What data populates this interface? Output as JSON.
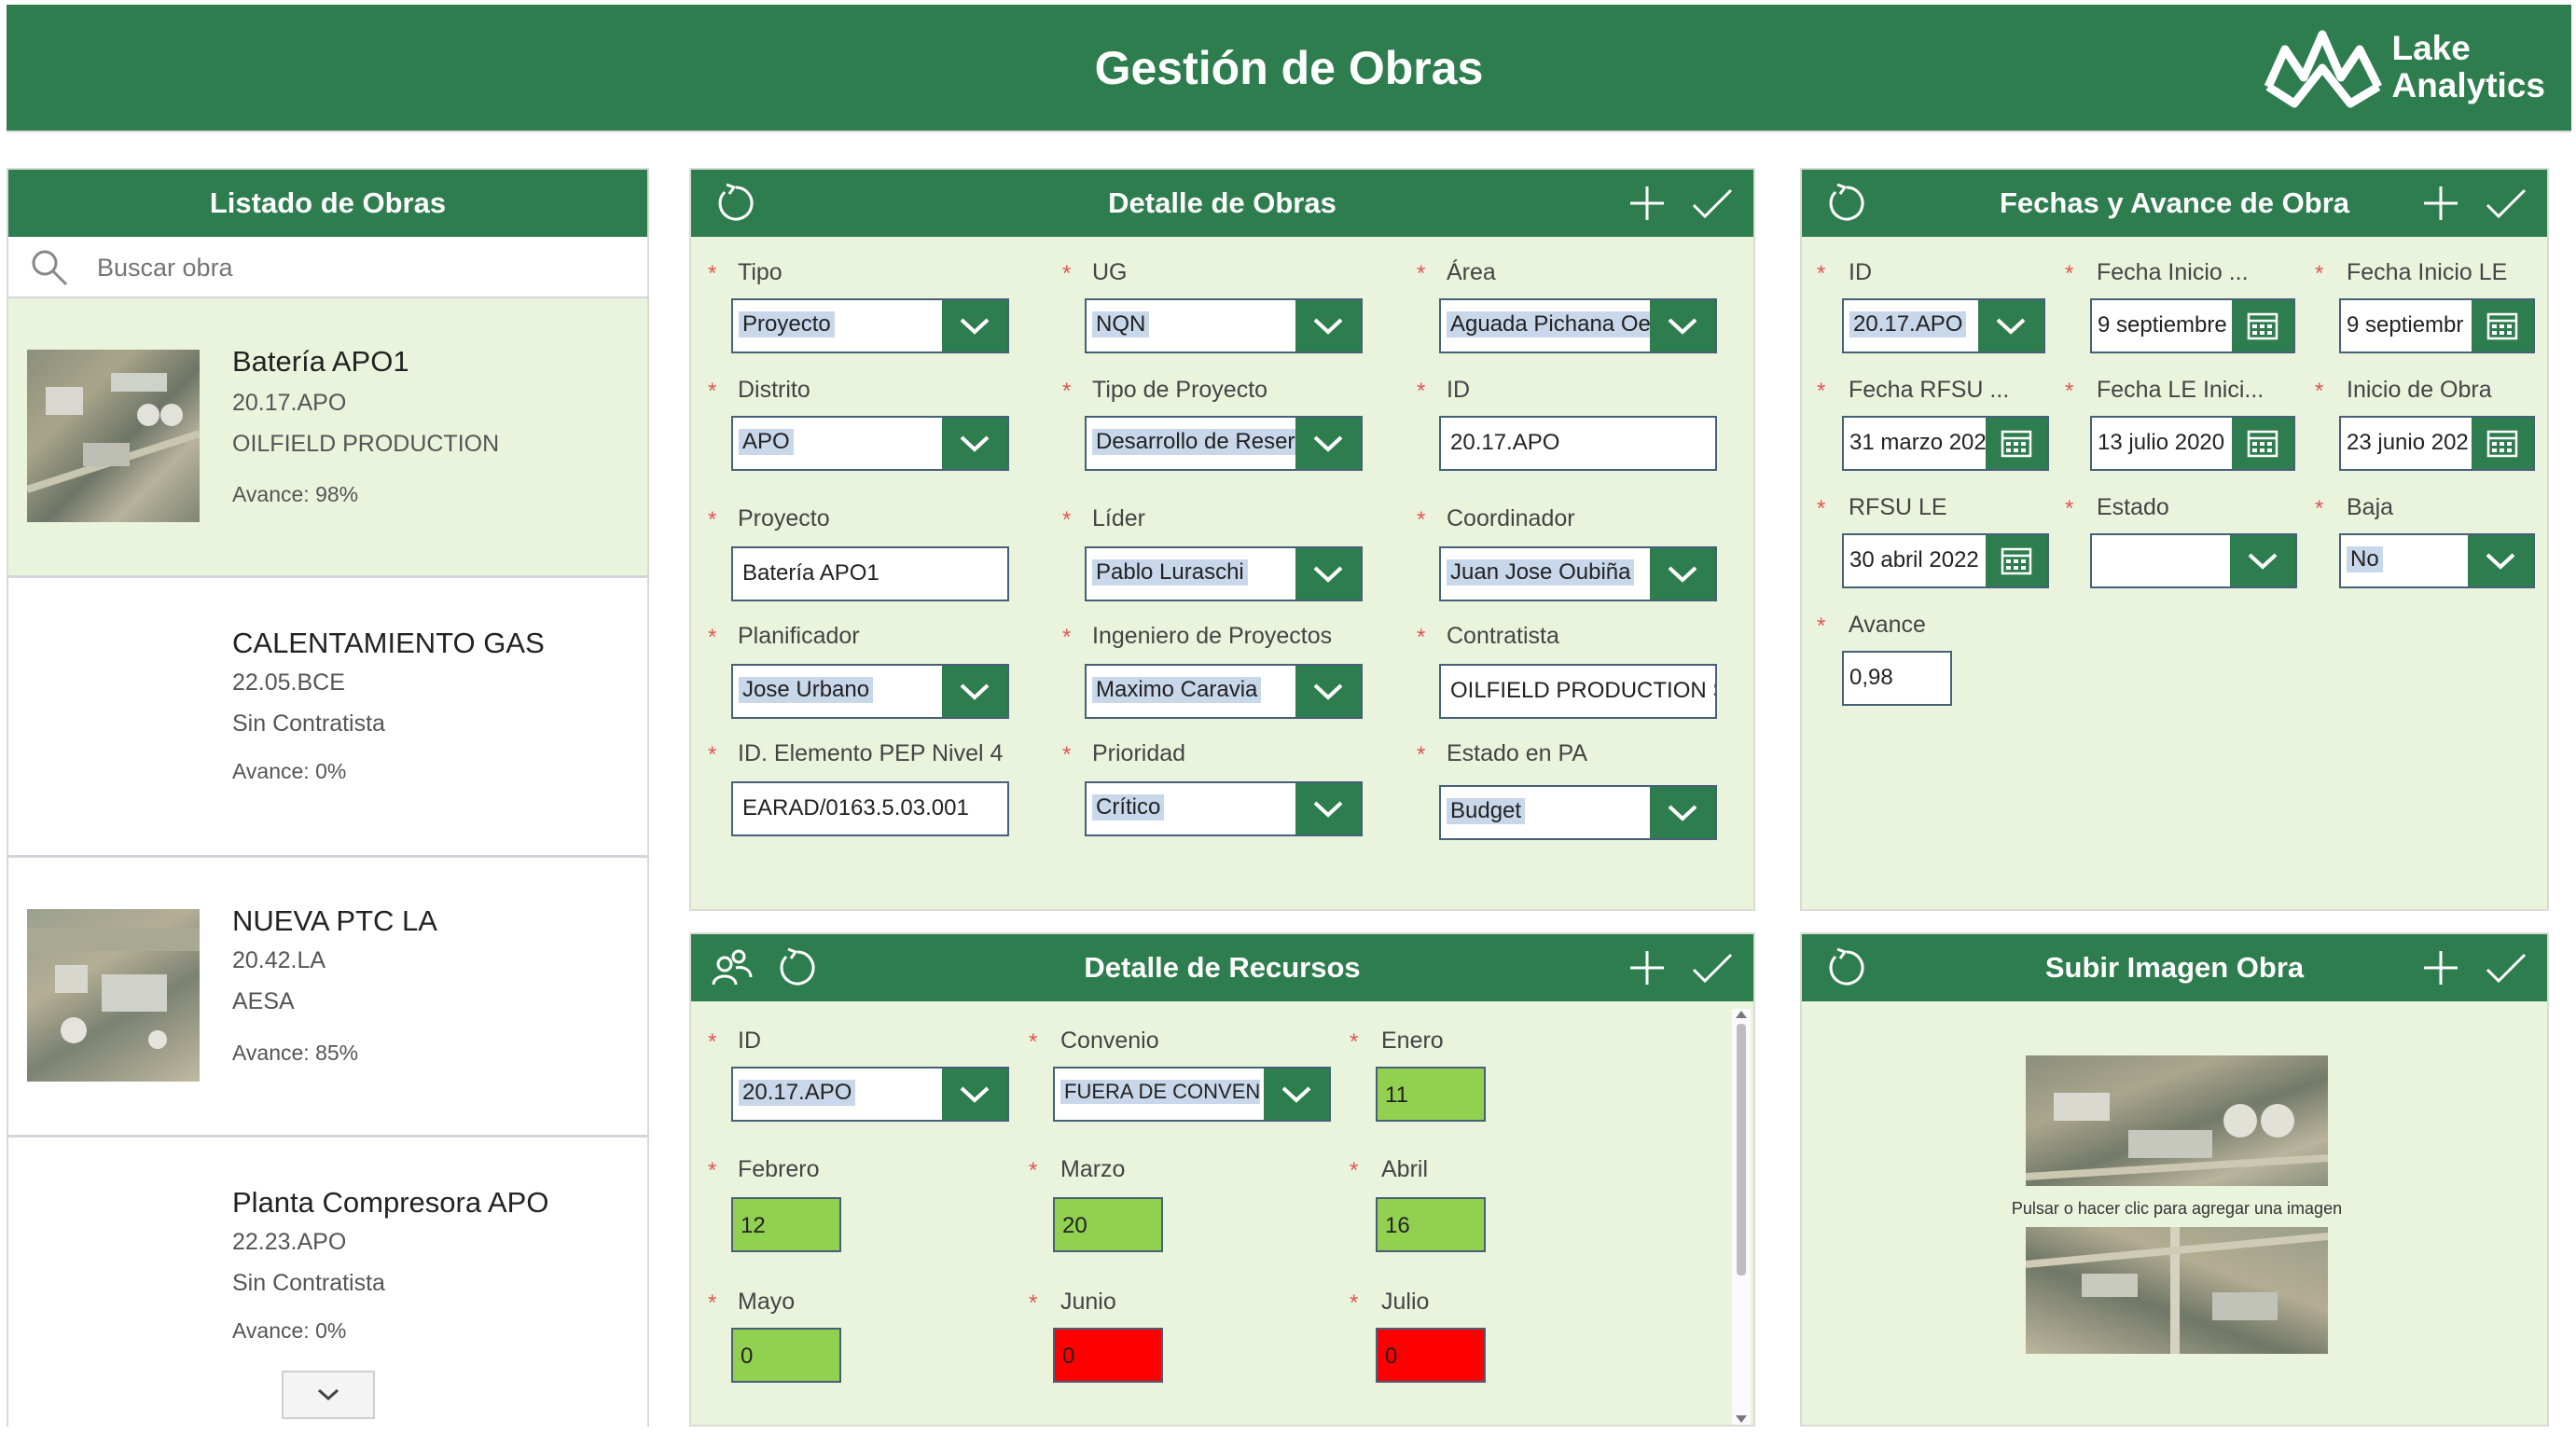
{
  "header": {
    "title": "Gestión de Obras",
    "logo_line1": "Lake",
    "logo_line2": "Analytics",
    "bg_color": "#2e7d4f"
  },
  "list_panel": {
    "title": "Listado de Obras",
    "search_placeholder": "Buscar obra",
    "items": [
      {
        "title": "Batería APO1",
        "code": "20.17.APO",
        "contractor": "OILFIELD PRODUCTION",
        "progress": "Avance: 98%",
        "has_image": true
      },
      {
        "title": "CALENTAMIENTO GAS",
        "code": "22.05.BCE",
        "contractor": "Sin Contratista",
        "progress": "Avance: 0%",
        "has_image": false
      },
      {
        "title": "NUEVA PTC LA",
        "code": "20.42.LA",
        "contractor": "AESA",
        "progress": "Avance: 85%",
        "has_image": true
      },
      {
        "title": "Planta Compresora APO",
        "code": "22.23.APO",
        "contractor": "Sin Contratista",
        "progress": "Avance: 0%",
        "has_image": false
      }
    ]
  },
  "detail_panel": {
    "title": "Detalle de Obras",
    "fields": {
      "tipo": {
        "label": "Tipo",
        "value": "Proyecto"
      },
      "ug": {
        "label": "UG",
        "value": "NQN"
      },
      "area": {
        "label": "Área",
        "value": "Aguada Pichana Oes"
      },
      "distrito": {
        "label": "Distrito",
        "value": "APO"
      },
      "tipo_proyecto": {
        "label": "Tipo de Proyecto",
        "value": "Desarrollo de Reserv"
      },
      "id": {
        "label": "ID",
        "value": "20.17.APO"
      },
      "proyecto": {
        "label": "Proyecto",
        "value": "Batería APO1"
      },
      "lider": {
        "label": "Líder",
        "value": "Pablo Luraschi"
      },
      "coordinador": {
        "label": "Coordinador",
        "value": "Juan Jose Oubiña"
      },
      "planificador": {
        "label": "Planificador",
        "value": "Jose Urbano"
      },
      "ingeniero": {
        "label": "Ingeniero de Proyectos",
        "value": "Maximo Caravia"
      },
      "contratista": {
        "label": "Contratista",
        "value": "OILFIELD PRODUCTION SER"
      },
      "pep": {
        "label": "ID. Elemento PEP Nivel 4",
        "value": "EARAD/0163.5.03.001"
      },
      "prioridad": {
        "label": "Prioridad",
        "value": "Crítico"
      },
      "estado_pa": {
        "label": "Estado en PA",
        "value": "Budget"
      }
    }
  },
  "fechas_panel": {
    "title": "Fechas y Avance de Obra",
    "fields": {
      "id": {
        "label": "ID",
        "value": "20.17.APO"
      },
      "fecha_inicio": {
        "label": "Fecha Inicio ...",
        "value": "9 septiembre"
      },
      "fecha_inicio_le": {
        "label": "Fecha Inicio LE",
        "value": "9 septiembr"
      },
      "fecha_rfsu": {
        "label": "Fecha RFSU ...",
        "value": "31 marzo 202"
      },
      "fecha_le_inici": {
        "label": "Fecha LE Inici...",
        "value": "13 julio 2020"
      },
      "inicio_obra": {
        "label": "Inicio de Obra",
        "value": "23 junio 202"
      },
      "rfsu_le": {
        "label": "RFSU LE",
        "value": "30 abril 2022"
      },
      "estado": {
        "label": "Estado",
        "value": ""
      },
      "baja": {
        "label": "Baja",
        "value": "No"
      },
      "avance": {
        "label": "Avance",
        "value": "0,98"
      }
    }
  },
  "recursos_panel": {
    "title": "Detalle de Recursos",
    "fields": {
      "id": {
        "label": "ID",
        "value": "20.17.APO"
      },
      "convenio": {
        "label": "Convenio",
        "value": "FUERA DE CONVENIO"
      },
      "enero": {
        "label": "Enero",
        "value": "11"
      },
      "febrero": {
        "label": "Febrero",
        "value": "12"
      },
      "marzo": {
        "label": "Marzo",
        "value": "20"
      },
      "abril": {
        "label": "Abril",
        "value": "16"
      },
      "mayo": {
        "label": "Mayo",
        "value": "0"
      },
      "junio": {
        "label": "Junio",
        "value": "0"
      },
      "julio": {
        "label": "Julio",
        "value": "0"
      }
    },
    "colors": {
      "green": "#92d050",
      "red": "#ff0000"
    }
  },
  "imagen_panel": {
    "title": "Subir Imagen Obra",
    "hint": "Pulsar o hacer clic para agregar una imagen"
  }
}
